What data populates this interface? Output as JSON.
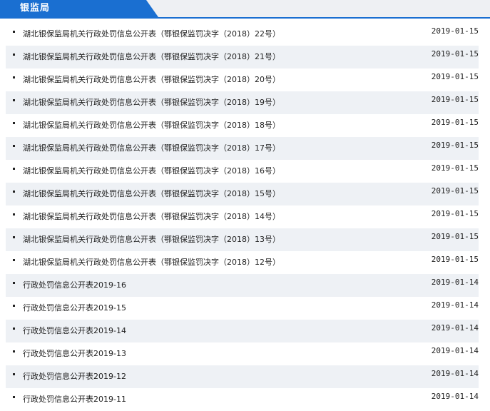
{
  "section": {
    "title": "银监局"
  },
  "items": [
    {
      "title": "湖北银保监局机关行政处罚信息公开表（鄂银保监罚决字（2018）22号）",
      "date": "2019-01-15"
    },
    {
      "title": "湖北银保监局机关行政处罚信息公开表（鄂银保监罚决字（2018）21号）",
      "date": "2019-01-15"
    },
    {
      "title": "湖北银保监局机关行政处罚信息公开表（鄂银保监罚决字（2018）20号）",
      "date": "2019-01-15"
    },
    {
      "title": "湖北银保监局机关行政处罚信息公开表（鄂银保监罚决字（2018）19号）",
      "date": "2019-01-15"
    },
    {
      "title": "湖北银保监局机关行政处罚信息公开表（鄂银保监罚决字（2018）18号）",
      "date": "2019-01-15"
    },
    {
      "title": "湖北银保监局机关行政处罚信息公开表（鄂银保监罚决字（2018）17号）",
      "date": "2019-01-15"
    },
    {
      "title": "湖北银保监局机关行政处罚信息公开表（鄂银保监罚决字（2018）16号）",
      "date": "2019-01-15"
    },
    {
      "title": "湖北银保监局机关行政处罚信息公开表（鄂银保监罚决字（2018）15号）",
      "date": "2019-01-15"
    },
    {
      "title": "湖北银保监局机关行政处罚信息公开表（鄂银保监罚决字（2018）14号）",
      "date": "2019-01-15"
    },
    {
      "title": "湖北银保监局机关行政处罚信息公开表（鄂银保监罚决字（2018）13号）",
      "date": "2019-01-15"
    },
    {
      "title": "湖北银保监局机关行政处罚信息公开表（鄂银保监罚决字（2018）12号）",
      "date": "2019-01-15"
    },
    {
      "title": "行政处罚信息公开表2019-16",
      "date": "2019-01-14"
    },
    {
      "title": "行政处罚信息公开表2019-15",
      "date": "2019-01-14"
    },
    {
      "title": "行政处罚信息公开表2019-14",
      "date": "2019-01-14"
    },
    {
      "title": "行政处罚信息公开表2019-13",
      "date": "2019-01-14"
    },
    {
      "title": "行政处罚信息公开表2019-12",
      "date": "2019-01-14"
    },
    {
      "title": "行政处罚信息公开表2019-11",
      "date": "2019-01-14"
    }
  ]
}
